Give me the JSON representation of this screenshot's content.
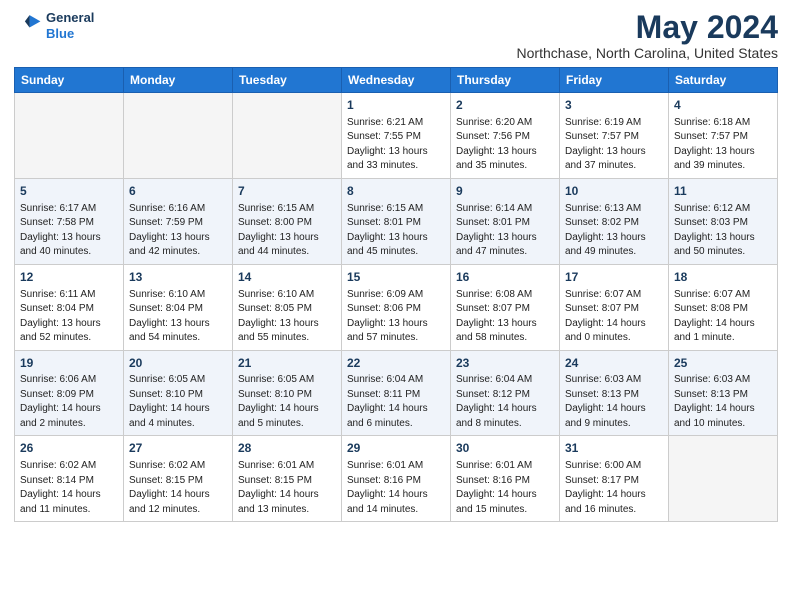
{
  "logo": {
    "line1": "General",
    "line2": "Blue"
  },
  "header": {
    "month": "May 2024",
    "location": "Northchase, North Carolina, United States"
  },
  "weekdays": [
    "Sunday",
    "Monday",
    "Tuesday",
    "Wednesday",
    "Thursday",
    "Friday",
    "Saturday"
  ],
  "weeks": [
    [
      {
        "day": "",
        "info": ""
      },
      {
        "day": "",
        "info": ""
      },
      {
        "day": "",
        "info": ""
      },
      {
        "day": "1",
        "info": "Sunrise: 6:21 AM\nSunset: 7:55 PM\nDaylight: 13 hours\nand 33 minutes."
      },
      {
        "day": "2",
        "info": "Sunrise: 6:20 AM\nSunset: 7:56 PM\nDaylight: 13 hours\nand 35 minutes."
      },
      {
        "day": "3",
        "info": "Sunrise: 6:19 AM\nSunset: 7:57 PM\nDaylight: 13 hours\nand 37 minutes."
      },
      {
        "day": "4",
        "info": "Sunrise: 6:18 AM\nSunset: 7:57 PM\nDaylight: 13 hours\nand 39 minutes."
      }
    ],
    [
      {
        "day": "5",
        "info": "Sunrise: 6:17 AM\nSunset: 7:58 PM\nDaylight: 13 hours\nand 40 minutes."
      },
      {
        "day": "6",
        "info": "Sunrise: 6:16 AM\nSunset: 7:59 PM\nDaylight: 13 hours\nand 42 minutes."
      },
      {
        "day": "7",
        "info": "Sunrise: 6:15 AM\nSunset: 8:00 PM\nDaylight: 13 hours\nand 44 minutes."
      },
      {
        "day": "8",
        "info": "Sunrise: 6:15 AM\nSunset: 8:01 PM\nDaylight: 13 hours\nand 45 minutes."
      },
      {
        "day": "9",
        "info": "Sunrise: 6:14 AM\nSunset: 8:01 PM\nDaylight: 13 hours\nand 47 minutes."
      },
      {
        "day": "10",
        "info": "Sunrise: 6:13 AM\nSunset: 8:02 PM\nDaylight: 13 hours\nand 49 minutes."
      },
      {
        "day": "11",
        "info": "Sunrise: 6:12 AM\nSunset: 8:03 PM\nDaylight: 13 hours\nand 50 minutes."
      }
    ],
    [
      {
        "day": "12",
        "info": "Sunrise: 6:11 AM\nSunset: 8:04 PM\nDaylight: 13 hours\nand 52 minutes."
      },
      {
        "day": "13",
        "info": "Sunrise: 6:10 AM\nSunset: 8:04 PM\nDaylight: 13 hours\nand 54 minutes."
      },
      {
        "day": "14",
        "info": "Sunrise: 6:10 AM\nSunset: 8:05 PM\nDaylight: 13 hours\nand 55 minutes."
      },
      {
        "day": "15",
        "info": "Sunrise: 6:09 AM\nSunset: 8:06 PM\nDaylight: 13 hours\nand 57 minutes."
      },
      {
        "day": "16",
        "info": "Sunrise: 6:08 AM\nSunset: 8:07 PM\nDaylight: 13 hours\nand 58 minutes."
      },
      {
        "day": "17",
        "info": "Sunrise: 6:07 AM\nSunset: 8:07 PM\nDaylight: 14 hours\nand 0 minutes."
      },
      {
        "day": "18",
        "info": "Sunrise: 6:07 AM\nSunset: 8:08 PM\nDaylight: 14 hours\nand 1 minute."
      }
    ],
    [
      {
        "day": "19",
        "info": "Sunrise: 6:06 AM\nSunset: 8:09 PM\nDaylight: 14 hours\nand 2 minutes."
      },
      {
        "day": "20",
        "info": "Sunrise: 6:05 AM\nSunset: 8:10 PM\nDaylight: 14 hours\nand 4 minutes."
      },
      {
        "day": "21",
        "info": "Sunrise: 6:05 AM\nSunset: 8:10 PM\nDaylight: 14 hours\nand 5 minutes."
      },
      {
        "day": "22",
        "info": "Sunrise: 6:04 AM\nSunset: 8:11 PM\nDaylight: 14 hours\nand 6 minutes."
      },
      {
        "day": "23",
        "info": "Sunrise: 6:04 AM\nSunset: 8:12 PM\nDaylight: 14 hours\nand 8 minutes."
      },
      {
        "day": "24",
        "info": "Sunrise: 6:03 AM\nSunset: 8:13 PM\nDaylight: 14 hours\nand 9 minutes."
      },
      {
        "day": "25",
        "info": "Sunrise: 6:03 AM\nSunset: 8:13 PM\nDaylight: 14 hours\nand 10 minutes."
      }
    ],
    [
      {
        "day": "26",
        "info": "Sunrise: 6:02 AM\nSunset: 8:14 PM\nDaylight: 14 hours\nand 11 minutes."
      },
      {
        "day": "27",
        "info": "Sunrise: 6:02 AM\nSunset: 8:15 PM\nDaylight: 14 hours\nand 12 minutes."
      },
      {
        "day": "28",
        "info": "Sunrise: 6:01 AM\nSunset: 8:15 PM\nDaylight: 14 hours\nand 13 minutes."
      },
      {
        "day": "29",
        "info": "Sunrise: 6:01 AM\nSunset: 8:16 PM\nDaylight: 14 hours\nand 14 minutes."
      },
      {
        "day": "30",
        "info": "Sunrise: 6:01 AM\nSunset: 8:16 PM\nDaylight: 14 hours\nand 15 minutes."
      },
      {
        "day": "31",
        "info": "Sunrise: 6:00 AM\nSunset: 8:17 PM\nDaylight: 14 hours\nand 16 minutes."
      },
      {
        "day": "",
        "info": ""
      }
    ]
  ]
}
